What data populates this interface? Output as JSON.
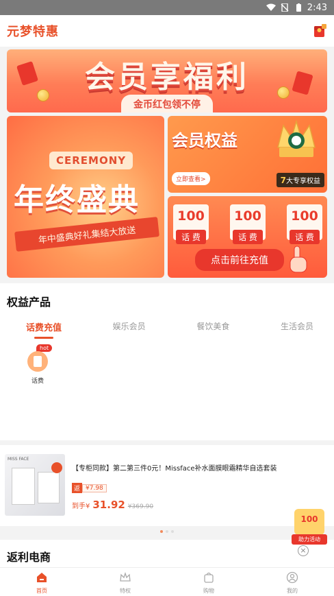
{
  "status_bar": {
    "time": "2:43"
  },
  "header": {
    "brand": "元梦特惠"
  },
  "hero": {
    "title": "会员享福利",
    "subtitle": "金币红包领不停"
  },
  "promo": {
    "left": {
      "tag": "CEREMONY",
      "title": "年终盛典",
      "ribbon": "年中盛典好礼集结大放送"
    },
    "rights": {
      "title": "会员权益",
      "button": "立即查看>",
      "badge_num": "7",
      "badge_text": "大专享权益"
    },
    "topup": {
      "coupons": [
        {
          "value": "100",
          "label": "话 费"
        },
        {
          "value": "100",
          "label": "话 费"
        },
        {
          "value": "100",
          "label": "话 费"
        }
      ],
      "cta": "点击前往充值"
    }
  },
  "benefits": {
    "title": "权益产品",
    "tabs": [
      {
        "label": "话费充值"
      },
      {
        "label": "娱乐会员"
      },
      {
        "label": "餐饮美食"
      },
      {
        "label": "生活会员"
      }
    ],
    "products": [
      {
        "label": "话费",
        "badge": "hot"
      }
    ]
  },
  "goods": {
    "brand": "MISS FACE",
    "title": "【专柜同款】第二第三件0元！Missface补水面膜眼霜精华自选套装",
    "rebate_tag": "返",
    "rebate_value": "¥7.98",
    "price_label": "到手¥",
    "price_now": "31.92",
    "price_old": "¥369.90"
  },
  "floating": {
    "value": "100",
    "label": "助力活动"
  },
  "section2": {
    "title": "返利电商"
  },
  "bottom_nav": [
    {
      "label": "首页",
      "icon": "home-icon"
    },
    {
      "label": "特权",
      "icon": "crown-icon"
    },
    {
      "label": "购物",
      "icon": "bag-icon"
    },
    {
      "label": "我的",
      "icon": "user-icon"
    }
  ],
  "colors": {
    "accent": "#e8512a",
    "red": "#e8372c"
  }
}
